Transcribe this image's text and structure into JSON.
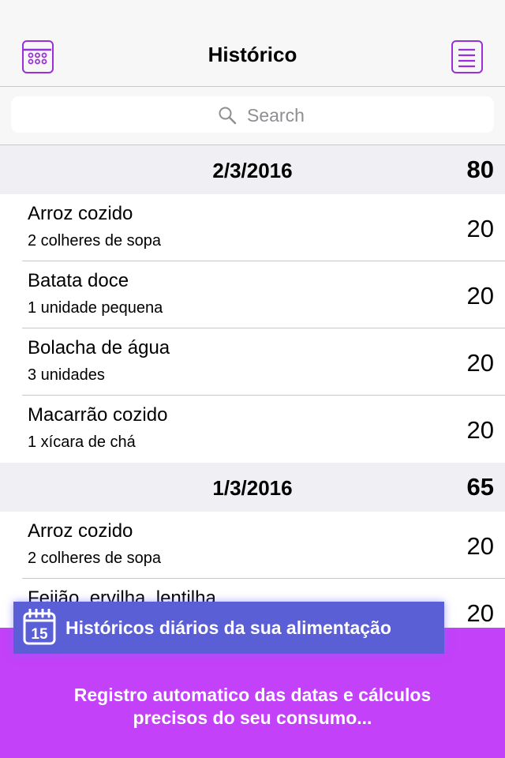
{
  "navbar": {
    "title": "Histórico",
    "left_icon": "calendar-icon",
    "right_icon": "list-icon",
    "accent": "#9b30d8"
  },
  "search": {
    "placeholder": "Search"
  },
  "sections": [
    {
      "date": "2/3/2016",
      "total": "80",
      "rows": [
        {
          "name": "Arroz cozido",
          "qty": "2 colheres de sopa",
          "value": "20"
        },
        {
          "name": "Batata doce",
          "qty": "1 unidade pequena",
          "value": "20"
        },
        {
          "name": "Bolacha de água",
          "qty": "3 unidades",
          "value": "20"
        },
        {
          "name": "Macarrão cozido",
          "qty": "1 xícara de chá",
          "value": "20"
        }
      ]
    },
    {
      "date": "1/3/2016",
      "total": "65",
      "rows": [
        {
          "name": "Arroz cozido",
          "qty": "2 colheres de sopa",
          "value": "20"
        },
        {
          "name": "Feijão, ervilha, lentilha",
          "qty": "",
          "value": "20"
        }
      ]
    }
  ],
  "promo": {
    "banner_icon": "calendar-15-icon",
    "banner_day": "15",
    "banner_text": "Históricos diários da sua alimentação",
    "description_line1": "Registro automatico das datas e cálculos",
    "description_line2": "precisos do seu consumo...",
    "bg_color": "#c341f8",
    "banner_color": "#5a5fd6"
  }
}
